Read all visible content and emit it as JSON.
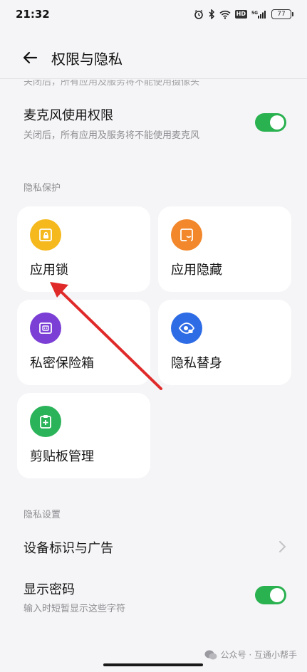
{
  "status_bar": {
    "time": "21:32",
    "battery": "77",
    "network": "5G",
    "hd": "HD"
  },
  "header": {
    "title": "权限与隐私"
  },
  "cut_row": {
    "subtitle": "关闭后，所有应用及服务将不能使用摄像头"
  },
  "microphone": {
    "title": "麦克风使用权限",
    "subtitle": "关闭后，所有应用及服务将不能使用麦克风",
    "enabled": true
  },
  "privacy_protection": {
    "section_label": "隐私保护",
    "cards": [
      {
        "label": "应用锁",
        "icon": "app-lock-icon",
        "color": "#f5b91e"
      },
      {
        "label": "应用隐藏",
        "icon": "app-hide-icon",
        "color": "#f2872b"
      },
      {
        "label": "私密保险箱",
        "icon": "safe-box-icon",
        "color": "#7b3fd6"
      },
      {
        "label": "隐私替身",
        "icon": "privacy-eye-icon",
        "color": "#2e6ce6"
      },
      {
        "label": "剪贴板管理",
        "icon": "clipboard-icon",
        "color": "#2bb35a"
      }
    ]
  },
  "privacy_settings": {
    "section_label": "隐私设置",
    "device_ads": {
      "title": "设备标识与广告"
    },
    "show_password": {
      "title": "显示密码",
      "subtitle": "输入时短暂显示这些字符",
      "enabled": true
    }
  },
  "watermark": {
    "text": "公众号 · 互通小帮手"
  },
  "colors": {
    "toggle_on": "#2ab150",
    "annotation_arrow": "#e02a2a"
  }
}
